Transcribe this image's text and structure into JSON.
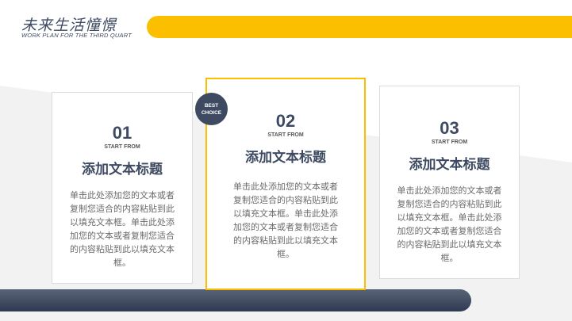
{
  "header": {
    "title_cn": "未来生活憧憬",
    "subtitle_en": "WORK PLAN FOR THE THIRD QUART"
  },
  "badge": {
    "line1": "BEST",
    "line2": "CHOICE"
  },
  "cards": [
    {
      "number": "01",
      "start": "START FROM",
      "title": "添加文本标题",
      "body": "单击此处添加您的文本或者复制您适合的内容粘贴到此以填充文本框。单击此处添加您的文本或者复制您适合的内容粘贴到此以填充文本框。"
    },
    {
      "number": "02",
      "start": "START FROM",
      "title": "添加文本标题",
      "body": "单击此处添加您的文本或者复制您适合的内容粘贴到此以填充文本框。单击此处添加您的文本或者复制您适合的内容粘贴到此以填充文本框。"
    },
    {
      "number": "03",
      "start": "START FROM",
      "title": "添加文本标题",
      "body": "单击此处添加您的文本或者复制您适合的内容粘贴到此以填充文本框。单击此处添加您的文本或者复制您适合的内容粘贴到此以填充文本框。"
    }
  ],
  "colors": {
    "accent": "#fbbf00",
    "navy": "#3d4a61",
    "gray_bg": "#f2f2f2"
  }
}
